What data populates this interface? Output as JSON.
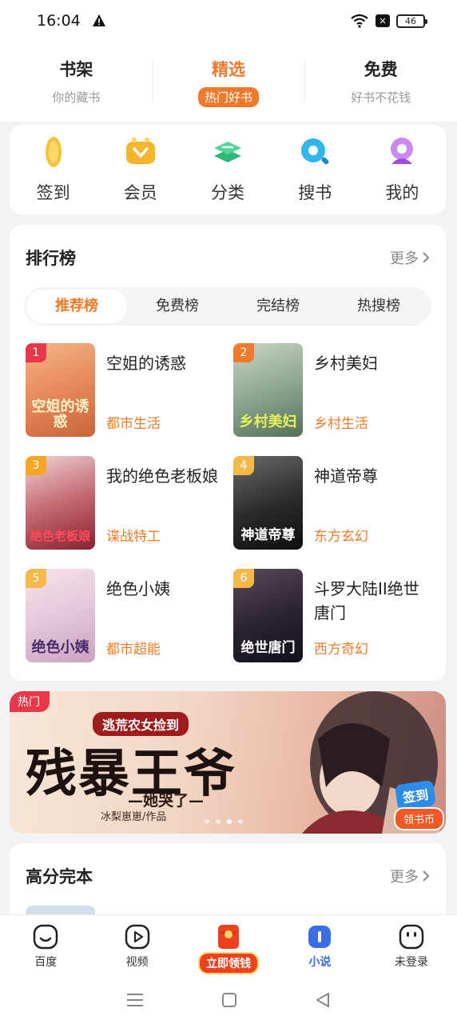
{
  "status_bar": {
    "time": "16:04",
    "battery": "46",
    "icons": [
      "warning-icon",
      "wifi-icon",
      "close-box-icon",
      "battery-icon"
    ]
  },
  "top_tabs": [
    {
      "title": "书架",
      "subtitle": "你的藏书",
      "active": false
    },
    {
      "title": "精选",
      "subtitle": "热门好书",
      "active": true
    },
    {
      "title": "免费",
      "subtitle": "好书不花钱",
      "active": false
    }
  ],
  "quick_nav": [
    {
      "label": "签到",
      "icon": "coin-icon"
    },
    {
      "label": "会员",
      "icon": "vip-icon"
    },
    {
      "label": "分类",
      "icon": "category-icon"
    },
    {
      "label": "搜书",
      "icon": "search-icon"
    },
    {
      "label": "我的",
      "icon": "profile-icon"
    }
  ],
  "ranking": {
    "title": "排行榜",
    "more": "更多",
    "tabs": [
      {
        "label": "推荐榜",
        "active": true
      },
      {
        "label": "免费榜",
        "active": false
      },
      {
        "label": "完结榜",
        "active": false
      },
      {
        "label": "热搜榜",
        "active": false
      }
    ],
    "books": [
      {
        "rank": "1",
        "title": "空姐的诱惑",
        "genre": "都市生活",
        "cover_text": "空姐的诱惑"
      },
      {
        "rank": "2",
        "title": "乡村美妇",
        "genre": "乡村生活",
        "cover_text": "乡村美妇"
      },
      {
        "rank": "3",
        "title": "我的绝色老板娘",
        "genre": "谍战特工",
        "cover_text": "绝色老板娘"
      },
      {
        "rank": "4",
        "title": "神道帝尊",
        "genre": "东方玄幻",
        "cover_text": "神道帝尊"
      },
      {
        "rank": "5",
        "title": "绝色小姨",
        "genre": "都市超能",
        "cover_text": "绝色小姨"
      },
      {
        "rank": "6",
        "title": "斗罗大陆II绝世唐门",
        "genre": "西方奇幻",
        "cover_text": "绝世唐门"
      }
    ]
  },
  "banner": {
    "badge": "热门",
    "subtitle": "逃荒农女捡到",
    "title": "残暴王爷",
    "tagline": "—她哭了—",
    "author": "冰梨崽崽/作品",
    "signin_top": "签到",
    "signin_bottom": "领书币"
  },
  "high_score": {
    "title": "高分完本",
    "more": "更多"
  },
  "bottom_nav": [
    {
      "label": "百度",
      "icon": "baidu-icon",
      "active": false
    },
    {
      "label": "视频",
      "icon": "video-icon",
      "active": false
    },
    {
      "label": "立即领钱",
      "icon": "red-envelope-icon",
      "active": false
    },
    {
      "label": "小说",
      "icon": "novel-icon",
      "active": true
    },
    {
      "label": "未登录",
      "icon": "user-face-icon",
      "active": false
    }
  ],
  "colors": {
    "accent": "#f07a2c",
    "nav_active": "#3a6ee8",
    "rank_badges": [
      "#e8384a",
      "#f07a2c",
      "#f5a623",
      "#f5b94a",
      "#f5b94a",
      "#f5b94a"
    ]
  }
}
